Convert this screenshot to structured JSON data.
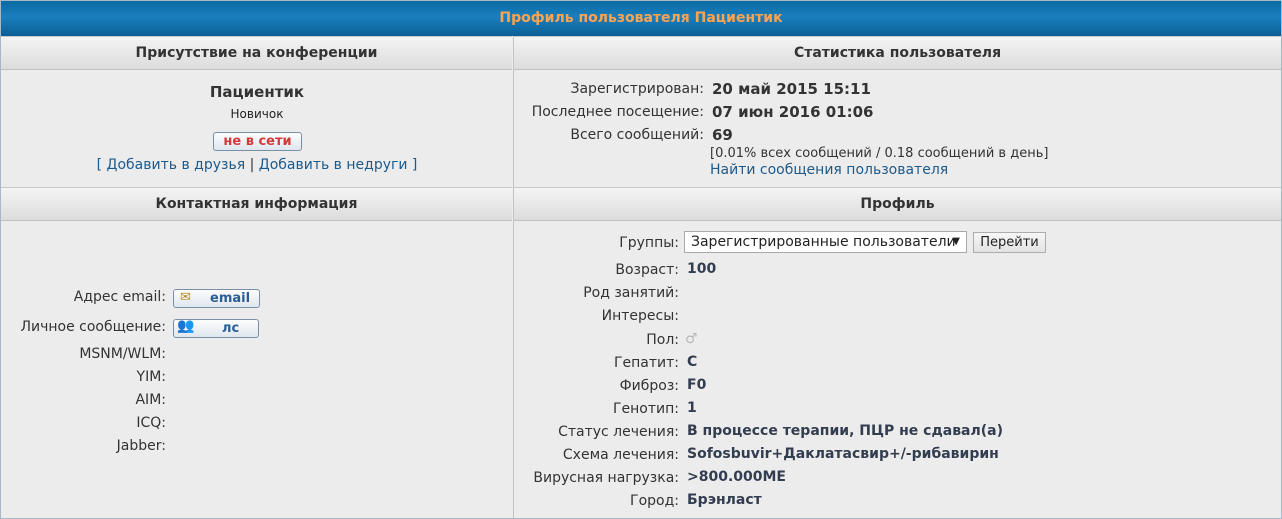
{
  "title": "Профиль пользователя Пациентик",
  "presence": {
    "header": "Присутствие на конференции",
    "username": "Пациентик",
    "rank": "Новичок",
    "offline_label": "не в сети",
    "bracket_open": "[",
    "add_friend": "Добавить в друзья",
    "separator": "|",
    "add_foe": "Добавить в недруги",
    "bracket_close": "]"
  },
  "stats": {
    "header": "Статистика пользователя",
    "registered_label": "Зарегистрирован:",
    "registered_value": "20 май 2015 15:11",
    "last_visit_label": "Последнее посещение:",
    "last_visit_value": "07 июн 2016 01:06",
    "posts_label": "Всего сообщений:",
    "posts_value": "69",
    "posts_detail": "[0.01% всех сообщений / 0.18 сообщений в день]",
    "find_posts": "Найти сообщения пользователя"
  },
  "contact": {
    "header": "Контактная информация",
    "email_label": "Адрес email:",
    "email_button": "email",
    "pm_label": "Личное сообщение:",
    "pm_button": "лс",
    "msnm_label": "MSNM/WLM:",
    "yim_label": "YIM:",
    "aim_label": "AIM:",
    "icq_label": "ICQ:",
    "jabber_label": "Jabber:"
  },
  "profile": {
    "header": "Профиль",
    "groups_label": "Группы:",
    "groups_selected": "Зарегистрированные пользователи",
    "go_button": "Перейти",
    "fields": [
      {
        "label": "Возраст:",
        "value": "100"
      },
      {
        "label": "Род занятий:",
        "value": ""
      },
      {
        "label": "Интересы:",
        "value": ""
      },
      {
        "label": "Пол:",
        "value": "♂"
      },
      {
        "label": "Гепатит:",
        "value": "C"
      },
      {
        "label": "Фиброз:",
        "value": "F0"
      },
      {
        "label": "Генотип:",
        "value": "1"
      },
      {
        "label": "Статус лечения:",
        "value": "В процессе терапии, ПЦР не сдавал(а)"
      },
      {
        "label": "Схема лечения:",
        "value": "Sofosbuvir+Даклатасвир+/-рибавирин"
      },
      {
        "label": "Вирусная нагрузка:",
        "value": ">800.000МЕ"
      },
      {
        "label": "Город:",
        "value": "Брэнласт"
      }
    ]
  },
  "colors": {
    "title_bar": "#0a6aa1",
    "title_text": "#ffa34f",
    "link": "#1c5a8c",
    "offline": "#d23a3a"
  }
}
